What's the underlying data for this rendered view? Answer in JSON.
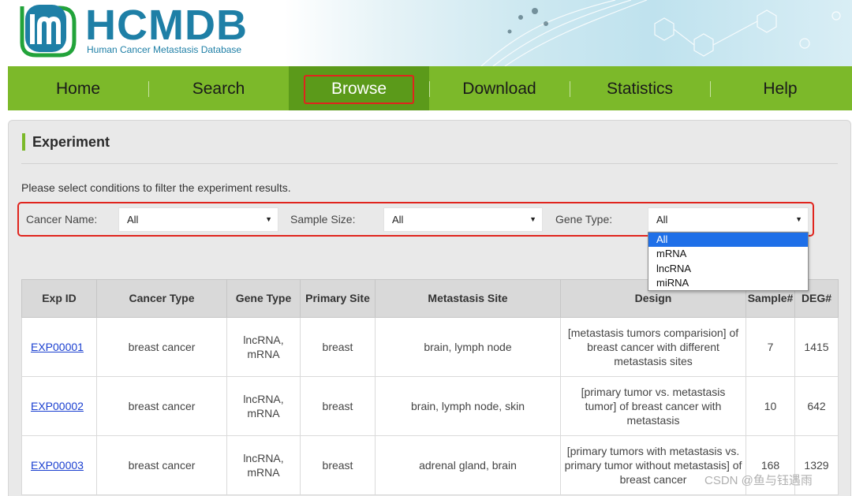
{
  "header": {
    "logo_text": "HCMDB",
    "logo_subtitle": "Human Cancer Metastasis Database"
  },
  "nav": {
    "items": [
      {
        "label": "Home"
      },
      {
        "label": "Search"
      },
      {
        "label": "Browse"
      },
      {
        "label": "Download"
      },
      {
        "label": "Statistics"
      },
      {
        "label": "Help"
      }
    ],
    "active": "Browse"
  },
  "section": {
    "title": "Experiment",
    "instruction": "Please select conditions to filter the experiment results."
  },
  "filters": {
    "cancer_name": {
      "label": "Cancer Name:",
      "value": "All"
    },
    "sample_size": {
      "label": "Sample Size:",
      "value": "All"
    },
    "gene_type": {
      "label": "Gene Type:",
      "value": "All",
      "options": [
        "All",
        "mRNA",
        "lncRNA",
        "miRNA"
      ]
    }
  },
  "table": {
    "headers": [
      "Exp ID",
      "Cancer Type",
      "Gene Type",
      "Primary Site",
      "Metastasis Site",
      "Design",
      "Sample#",
      "DEG#"
    ],
    "rows": [
      {
        "exp_id": "EXP00001",
        "cancer_type": "breast cancer",
        "gene_type": "lncRNA, mRNA",
        "primary_site": "breast",
        "metastasis_site": "brain, lymph node",
        "design": "[metastasis tumors comparision] of breast cancer with different metastasis sites",
        "sample": "7",
        "deg": "1415"
      },
      {
        "exp_id": "EXP00002",
        "cancer_type": "breast cancer",
        "gene_type": "lncRNA, mRNA",
        "primary_site": "breast",
        "metastasis_site": "brain, lymph node, skin",
        "design": "[primary tumor vs. metastasis tumor] of breast cancer with metastasis",
        "sample": "10",
        "deg": "642"
      },
      {
        "exp_id": "EXP00003",
        "cancer_type": "breast cancer",
        "gene_type": "lncRNA, mRNA",
        "primary_site": "breast",
        "metastasis_site": "adrenal gland, brain",
        "design": "[primary tumors with metastasis vs. primary tumor without metastasis] of breast cancer",
        "sample": "168",
        "deg": "1329"
      }
    ]
  },
  "watermark": "CSDN @鱼与钰遇雨",
  "colors": {
    "brand_blue": "#1e7fa6",
    "nav_green": "#7cb92a",
    "nav_active": "#5b9a1a",
    "highlight_red": "#e0241d",
    "link_blue": "#1a3fd0"
  }
}
